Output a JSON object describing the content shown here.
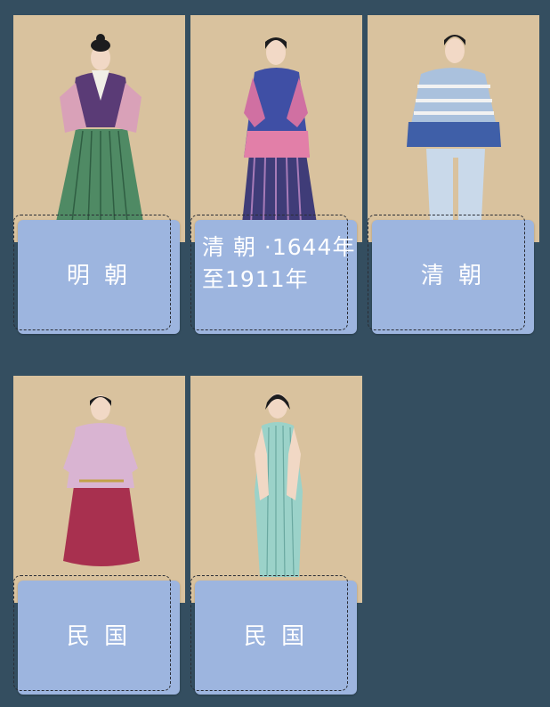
{
  "cards": [
    {
      "caption": "明朝",
      "caption_display": "明 朝",
      "figure": "ming-dynasty-costume-figure"
    },
    {
      "caption": "清 朝 ·1644年至1911年",
      "caption_display": "清 朝 ·1644年至1911年",
      "figure": "qing-dynasty-costume-figure"
    },
    {
      "caption": "清朝",
      "caption_display": "清 朝",
      "figure": "qing-dynasty-costume-figure"
    },
    {
      "caption": "民国",
      "caption_display": "民 国",
      "figure": "republic-era-costume-figure"
    },
    {
      "caption": "民国",
      "caption_display": "民 国",
      "figure": "republic-era-qipao-figure"
    }
  ],
  "colors": {
    "page_background": "#344e60",
    "card_background": "#d8c19c",
    "caption_box": "#9db5df",
    "caption_text": "#ffffff"
  }
}
